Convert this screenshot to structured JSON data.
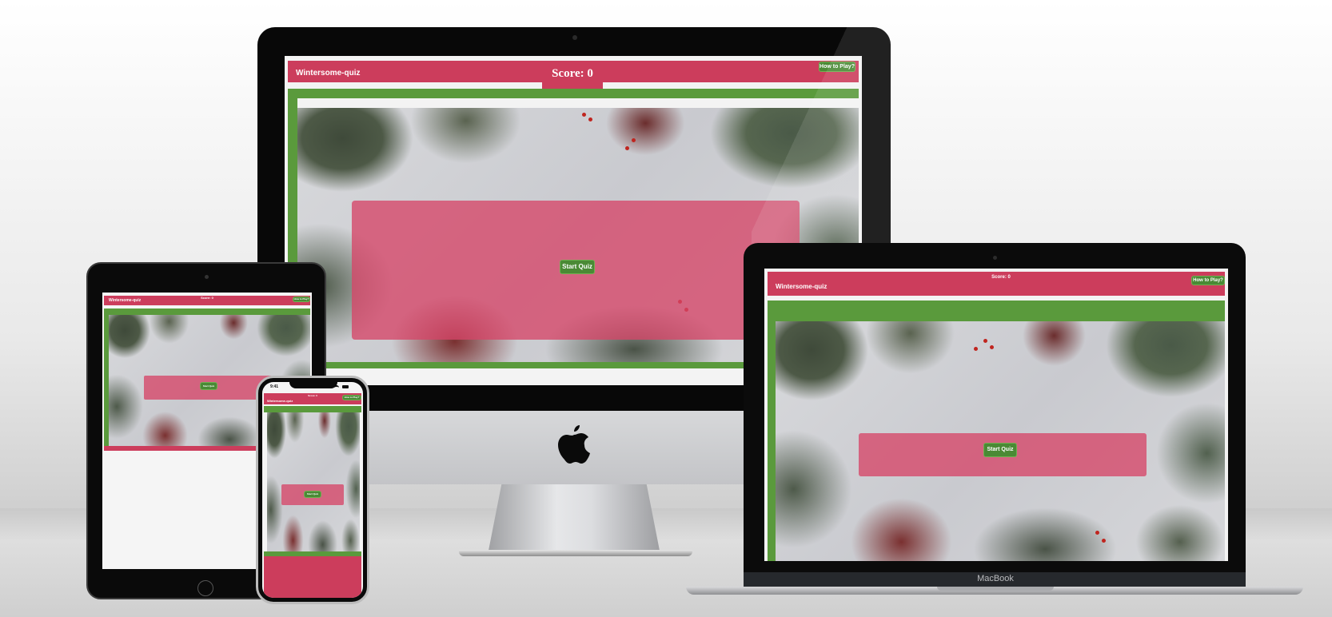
{
  "app": {
    "title": "Wintersome-quiz",
    "score_label": "Score: 0",
    "help_button": "How to Play?",
    "start_button": "Start Quiz"
  },
  "devices": {
    "iphone_time": "9:41",
    "laptop_brand": "MacBook"
  },
  "colors": {
    "header_pink": "#cc3d5c",
    "accent_green": "#5a9a3c",
    "overlay_pink": "#d64568",
    "button_green": "#4a8a35"
  },
  "icons": [
    "apple-logo-icon",
    "wifi-icon",
    "battery-icon"
  ]
}
